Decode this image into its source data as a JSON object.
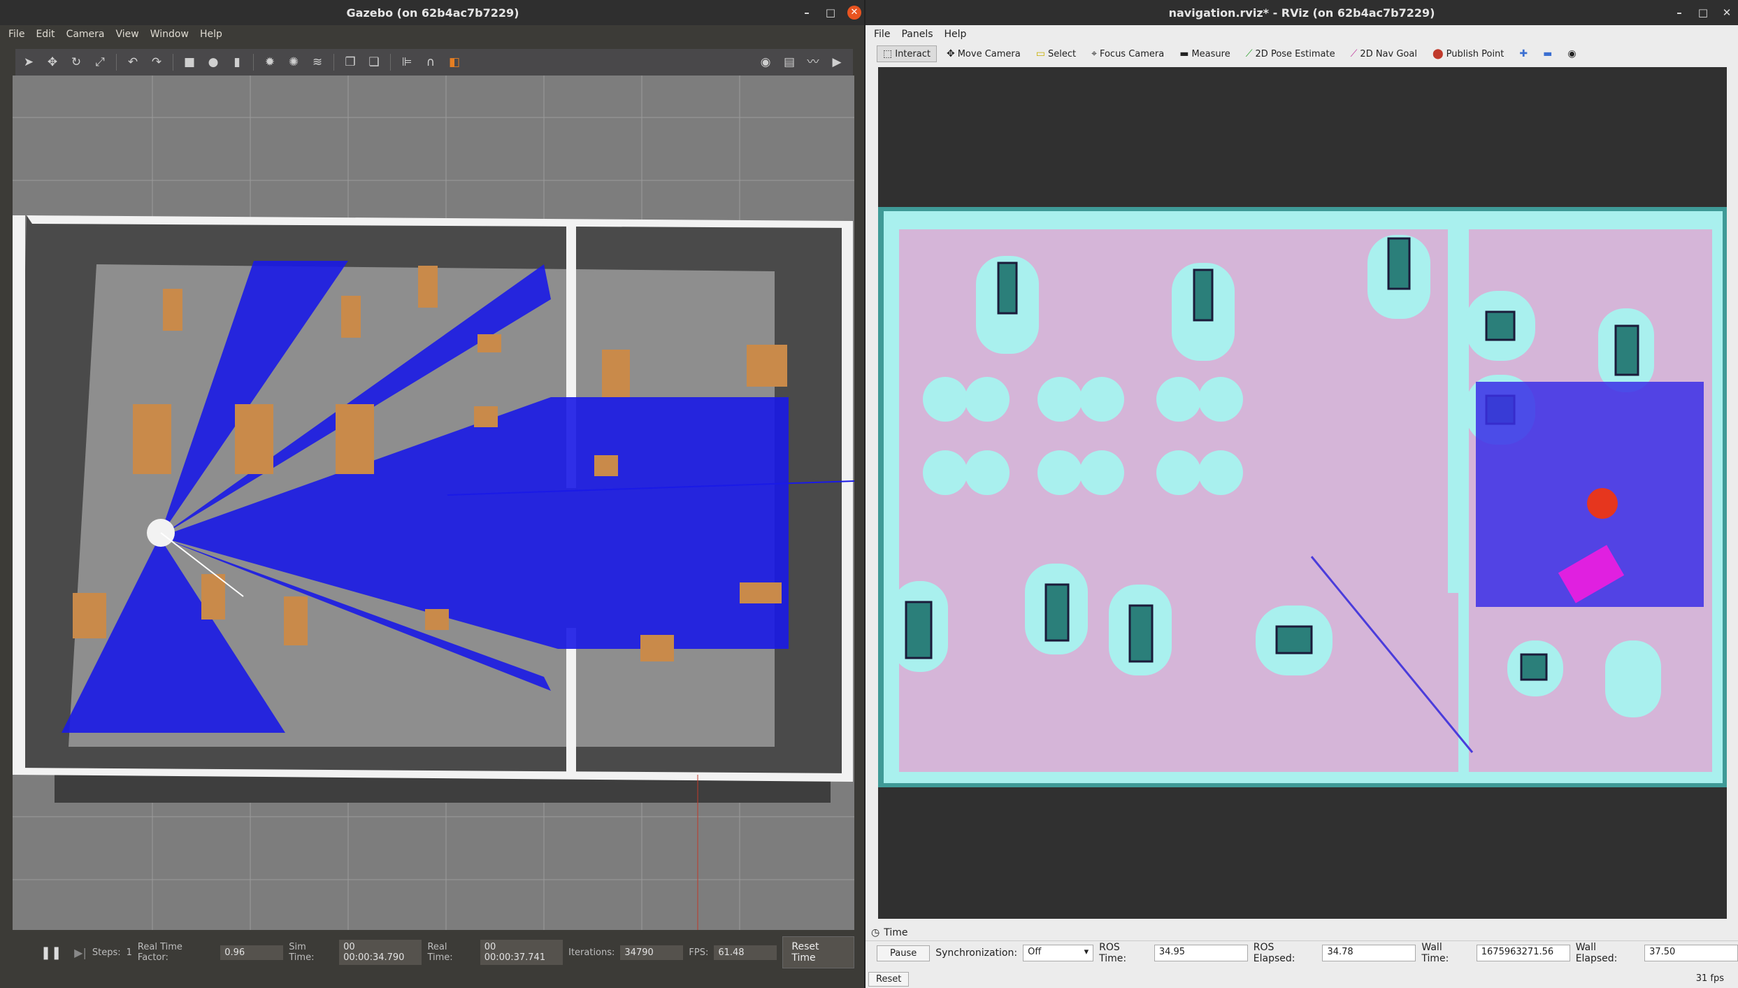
{
  "gazebo": {
    "title": "Gazebo (on 62b4ac7b7229)",
    "menu": [
      "File",
      "Edit",
      "Camera",
      "View",
      "Window",
      "Help"
    ],
    "toolbar_icons": [
      "select-arrow-icon",
      "translate-icon",
      "rotate-icon",
      "scale-icon",
      "undo-icon",
      "dropdown-icon",
      "redo-icon",
      "dropdown-icon",
      "box-icon",
      "sphere-icon",
      "cylinder-icon",
      "point-light-icon",
      "spot-light-icon",
      "directional-light-icon",
      "copy-icon",
      "paste-icon",
      "align-icon",
      "snap-icon",
      "view-angle-icon",
      "screenshot-icon",
      "log-icon",
      "plot-icon",
      "record-icon"
    ],
    "status": {
      "steps_label": "Steps:",
      "steps_value": "1",
      "rtf_label": "Real Time Factor:",
      "rtf_value": "0.96",
      "sim_time_label": "Sim Time:",
      "sim_time_value": "00 00:00:34.790",
      "real_time_label": "Real Time:",
      "real_time_value": "00 00:00:37.741",
      "iterations_label": "Iterations:",
      "iterations_value": "34790",
      "fps_label": "FPS:",
      "fps_value": "61.48",
      "reset_time": "Reset Time"
    }
  },
  "rviz": {
    "title": "navigation.rviz* - RViz (on 62b4ac7b7229)",
    "menu": [
      "File",
      "Panels",
      "Help"
    ],
    "tools": [
      {
        "label": "Interact",
        "icon": "interact-icon",
        "active": true
      },
      {
        "label": "Move Camera",
        "icon": "move-camera-icon",
        "active": false
      },
      {
        "label": "Select",
        "icon": "select-icon",
        "active": false
      },
      {
        "label": "Focus Camera",
        "icon": "focus-camera-icon",
        "active": false
      },
      {
        "label": "Measure",
        "icon": "measure-icon",
        "active": false
      },
      {
        "label": "2D Pose Estimate",
        "icon": "pose-estimate-icon",
        "active": false
      },
      {
        "label": "2D Nav Goal",
        "icon": "nav-goal-icon",
        "active": false
      },
      {
        "label": "Publish Point",
        "icon": "publish-point-icon",
        "active": false
      }
    ],
    "time_panel": {
      "header": "Time",
      "pause": "Pause",
      "sync_label": "Synchronization:",
      "sync_value": "Off",
      "ros_time_label": "ROS Time:",
      "ros_time_value": "34.95",
      "ros_elapsed_label": "ROS Elapsed:",
      "ros_elapsed_value": "34.78",
      "wall_time_label": "Wall Time:",
      "wall_time_value": "1675963271.56",
      "wall_elapsed_label": "Wall Elapsed:",
      "wall_elapsed_value": "37.50",
      "reset": "Reset",
      "fps": "31 fps"
    }
  },
  "colors": {
    "laser": "#1a1ae6",
    "costmap_inflation": "#a9f0ee",
    "costmap_lethal": "#2b7f7a",
    "map_free": "#c8b7e6",
    "local_costmap": "#3b2fe6",
    "robot": "#e6361e",
    "wall": "#f2f2f2"
  }
}
